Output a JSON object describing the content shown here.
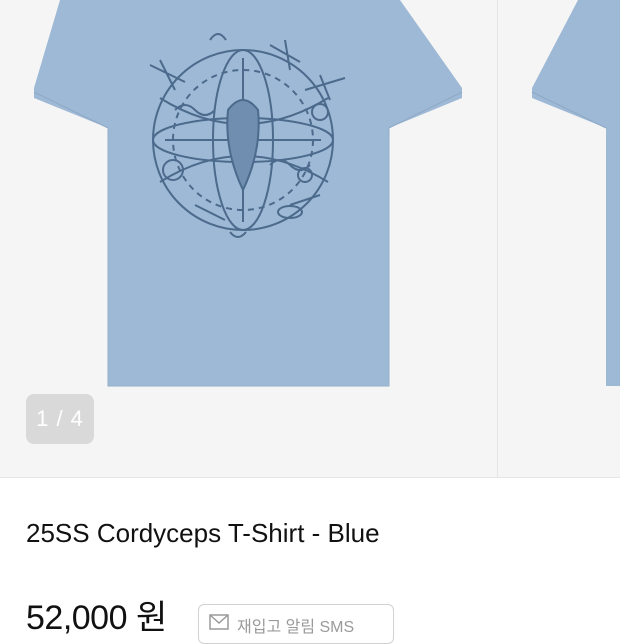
{
  "gallery": {
    "counter": "1 / 4",
    "product_color": "#9eb9d6",
    "print_color": "#4b6a8c",
    "main_image": "blue-tshirt-front-graphic",
    "next_image": "blue-tshirt-partial"
  },
  "product": {
    "title": "25SS Cordyceps T-Shirt - Blue",
    "price": "52,000 원",
    "restock_sms_label": "재입고 알림 SMS"
  }
}
